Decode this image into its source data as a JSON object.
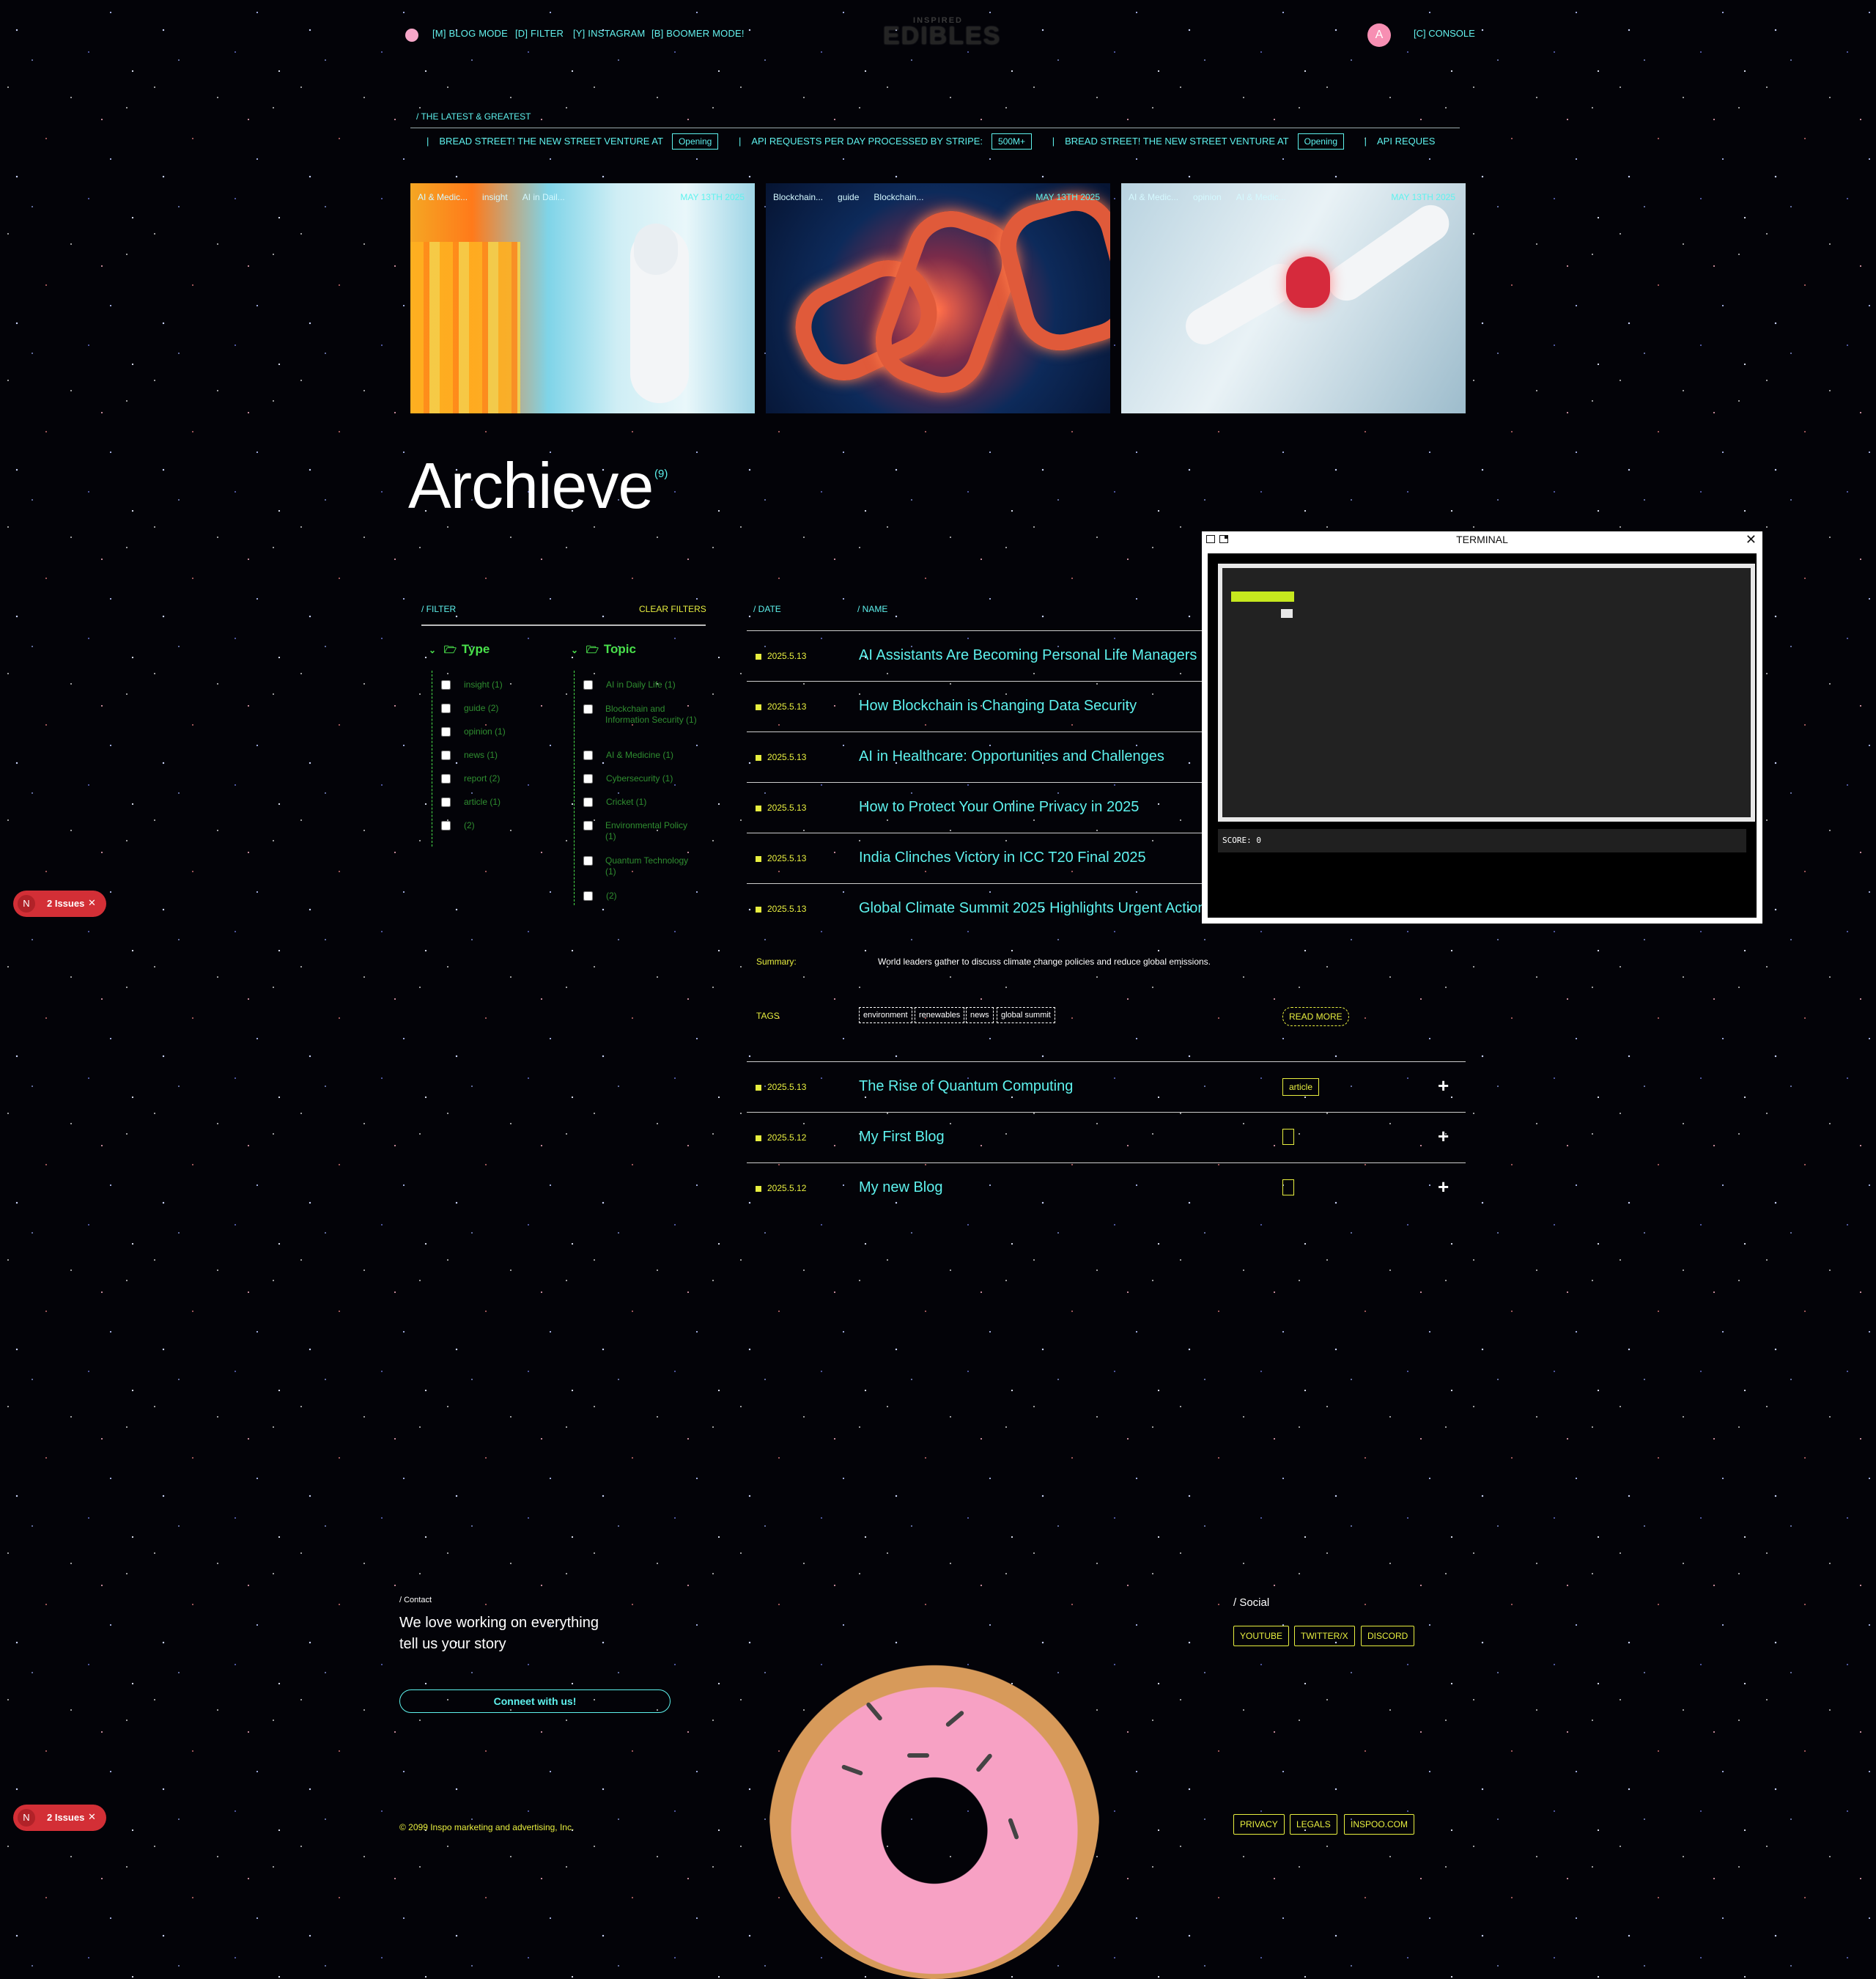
{
  "header": {
    "nav": [
      "[M] BLOG MODE",
      "[D] FILTER",
      "[Y] INSTAGRAM",
      "[B] BOOMER MODE!"
    ],
    "logo_small": "INSPIRED",
    "logo_big": "EDIBLES",
    "avatar_letter": "A",
    "console": "[C] CONSOLE"
  },
  "latest": {
    "label": "/ THE LATEST & GREATEST",
    "ticker": [
      {
        "text": "BREAD STREET! THE NEW STREET VENTURE AT",
        "pill": "Opening"
      },
      {
        "text": "API REQUESTS PER DAY PROCESSED BY STRIPE:",
        "pill": "500M+"
      },
      {
        "text": "BREAD STREET! THE NEW STREET VENTURE AT",
        "pill": "Opening"
      },
      {
        "text": "API REQUES",
        "pill": ""
      }
    ]
  },
  "cards": [
    {
      "tags": [
        "AI & Medic...",
        "insight",
        "AI in Dail..."
      ],
      "date": "MAY 13TH 2025"
    },
    {
      "tags": [
        "Blockchain...",
        "guide",
        "Blockchain..."
      ],
      "date": "MAY 13TH 2025"
    },
    {
      "tags": [
        "AI & Medic...",
        "opinion",
        "AI & Medic..."
      ],
      "date": "MAY 13TH 2025"
    }
  ],
  "archive": {
    "title": "Archieve",
    "count": "(9)"
  },
  "filter": {
    "label": "/ FILTER",
    "clear": "CLEAR FILTERS",
    "type_heading": "Type",
    "topic_heading": "Topic",
    "types": [
      "insight (1)",
      "guide (2)",
      "opinion (1)",
      "news (1)",
      "report (2)",
      "article (1)",
      "(2)"
    ],
    "topics": [
      "AI in Daily Life (1)",
      "Blockchain and Information Security (1)",
      "AI & Medicine (1)",
      "Cybersecurity (1)",
      "Cricket (1)",
      "Environmental Policy (1)",
      "Quantum Technology (1)",
      "(2)"
    ]
  },
  "list": {
    "date_label": "/ DATE",
    "name_label": "/ NAME",
    "rows": [
      {
        "date": "2025.5.13",
        "title": "AI Assistants Are Becoming Personal Life Managers"
      },
      {
        "date": "2025.5.13",
        "title": "How Blockchain is Changing Data Security"
      },
      {
        "date": "2025.5.13",
        "title": "AI in Healthcare: Opportunities and Challenges"
      },
      {
        "date": "2025.5.13",
        "title": "How to Protect Your Online Privacy in 2025"
      },
      {
        "date": "2025.5.13",
        "title": "India Clinches Victory in ICC T20 Final 2025"
      },
      {
        "date": "2025.5.13",
        "title": "Global Climate Summit 2025 Highlights Urgent Action"
      }
    ],
    "expanded": {
      "summary_label": "Summary:",
      "summary": "World leaders gather to discuss climate change policies and reduce global emissions.",
      "tags_label": "TAGS",
      "tags": [
        "environment",
        "renewables",
        "news",
        "global summit"
      ],
      "read_more": "READ MORE"
    },
    "rows2": [
      {
        "date": "2025.5.13",
        "title": "The Rise of Quantum Computing",
        "badge": "article"
      },
      {
        "date": "2025.5.12",
        "title": "My First Blog",
        "badge": ""
      },
      {
        "date": "2025.5.12",
        "title": "My new Blog",
        "badge": ""
      }
    ],
    "plus": "+"
  },
  "terminal": {
    "title": "TERMINAL",
    "score": "SCORE: 0",
    "close": "✕"
  },
  "issues": {
    "label": "2 Issues",
    "letter": "N",
    "close": "✕"
  },
  "footer": {
    "contact_label": "/ Contact",
    "contact_line1": "We love working on everything",
    "contact_line2": "tell us your story",
    "connect": "Conneet with us!",
    "copyright": "© 2099 Inspo marketing and advertising, Inc.",
    "social_label": "/ Social",
    "social": [
      "YOUTUBE",
      "TWITTER/X",
      "DISCORD"
    ],
    "legal": [
      "PRIVACY",
      "LEGALS",
      "INSPOO.COM"
    ]
  },
  "colors": {
    "accent": "#5ef2ee",
    "yellow": "#e8ef3f",
    "green": "#49e04b",
    "pink": "#f7a1c4"
  }
}
